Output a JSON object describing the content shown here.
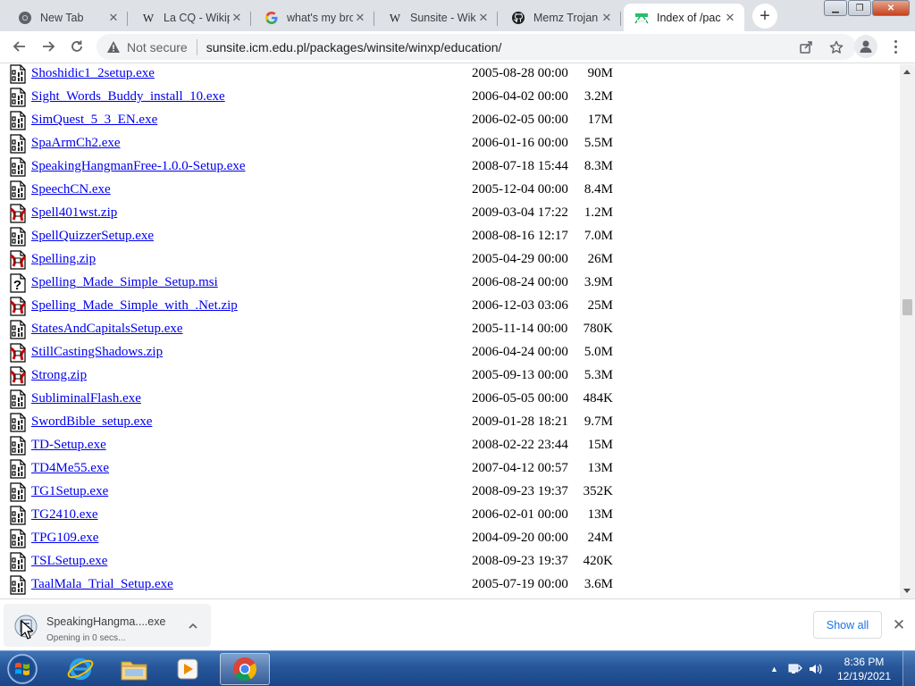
{
  "window": {
    "minimize": "▁",
    "maximize": "❐",
    "close": "✕"
  },
  "tabs": [
    {
      "title": "New Tab",
      "favicon": "chrome-icon",
      "active": false
    },
    {
      "title": "La CQ - Wikip",
      "favicon": "wikipedia-icon",
      "active": false
    },
    {
      "title": "what's my bro",
      "favicon": "google-icon",
      "active": false
    },
    {
      "title": "Sunsite - Wiki",
      "favicon": "wikipedia-icon",
      "active": false
    },
    {
      "title": "Memz Trojan",
      "favicon": "github-icon",
      "active": false
    },
    {
      "title": "Index of /pac",
      "favicon": "index-icon",
      "active": true
    }
  ],
  "toolbar": {
    "security_label": "Not secure",
    "url": "sunsite.icm.edu.pl/packages/winsite/winxp/education/"
  },
  "listing": [
    {
      "name": "Shoshidic1_2setup.exe",
      "date": "2005-08-28 00:00",
      "size": "90M",
      "icon": "binary-file-icon"
    },
    {
      "name": "Sight_Words_Buddy_install_10.exe",
      "date": "2006-04-02 00:00",
      "size": "3.2M",
      "icon": "binary-file-icon"
    },
    {
      "name": "SimQuest_5_3_EN.exe",
      "date": "2006-02-05 00:00",
      "size": "17M",
      "icon": "binary-file-icon"
    },
    {
      "name": "SpaArmCh2.exe",
      "date": "2006-01-16 00:00",
      "size": "5.5M",
      "icon": "binary-file-icon"
    },
    {
      "name": "SpeakingHangmanFree-1.0.0-Setup.exe",
      "date": "2008-07-18 15:44",
      "size": "8.3M",
      "icon": "binary-file-icon"
    },
    {
      "name": "SpeechCN.exe",
      "date": "2005-12-04 00:00",
      "size": "8.4M",
      "icon": "binary-file-icon"
    },
    {
      "name": "Spell401wst.zip",
      "date": "2009-03-04 17:22",
      "size": "1.2M",
      "icon": "compressed-file-icon"
    },
    {
      "name": "SpellQuizzerSetup.exe",
      "date": "2008-08-16 12:17",
      "size": "7.0M",
      "icon": "binary-file-icon"
    },
    {
      "name": "Spelling.zip",
      "date": "2005-04-29 00:00",
      "size": "26M",
      "icon": "compressed-file-icon"
    },
    {
      "name": "Spelling_Made_Simple_Setup.msi",
      "date": "2006-08-24 00:00",
      "size": "3.9M",
      "icon": "unknown-file-icon"
    },
    {
      "name": "Spelling_Made_Simple_with_.Net.zip",
      "date": "2006-12-03 03:06",
      "size": "25M",
      "icon": "compressed-file-icon"
    },
    {
      "name": "StatesAndCapitalsSetup.exe",
      "date": "2005-11-14 00:00",
      "size": "780K",
      "icon": "binary-file-icon"
    },
    {
      "name": "StillCastingShadows.zip",
      "date": "2006-04-24 00:00",
      "size": "5.0M",
      "icon": "compressed-file-icon"
    },
    {
      "name": "Strong.zip",
      "date": "2005-09-13 00:00",
      "size": "5.3M",
      "icon": "compressed-file-icon"
    },
    {
      "name": "SubliminalFlash.exe",
      "date": "2006-05-05 00:00",
      "size": "484K",
      "icon": "binary-file-icon"
    },
    {
      "name": "SwordBible_setup.exe",
      "date": "2009-01-28 18:21",
      "size": "9.7M",
      "icon": "binary-file-icon"
    },
    {
      "name": "TD-Setup.exe",
      "date": "2008-02-22 23:44",
      "size": "15M",
      "icon": "binary-file-icon"
    },
    {
      "name": "TD4Me55.exe",
      "date": "2007-04-12 00:57",
      "size": "13M",
      "icon": "binary-file-icon"
    },
    {
      "name": "TG1Setup.exe",
      "date": "2008-09-23 19:37",
      "size": "352K",
      "icon": "binary-file-icon"
    },
    {
      "name": "TG2410.exe",
      "date": "2006-02-01 00:00",
      "size": "13M",
      "icon": "binary-file-icon"
    },
    {
      "name": "TPG109.exe",
      "date": "2004-09-20 00:00",
      "size": "24M",
      "icon": "binary-file-icon"
    },
    {
      "name": "TSLSetup.exe",
      "date": "2008-09-23 19:37",
      "size": "420K",
      "icon": "binary-file-icon"
    },
    {
      "name": "TaalMala_Trial_Setup.exe",
      "date": "2005-07-19 00:00",
      "size": "3.6M",
      "icon": "binary-file-icon"
    }
  ],
  "scroll": {
    "position": 0.45
  },
  "download": {
    "filename": "SpeakingHangma....exe",
    "status": "Opening in 0 secs...",
    "show_all": "Show all"
  },
  "taskbar": {
    "apps": [
      "ie-icon",
      "explorer-icon",
      "media-player-icon",
      "chrome-icon"
    ],
    "active_app": "chrome-icon",
    "time": "8:36 PM",
    "date": "12/19/2021"
  }
}
